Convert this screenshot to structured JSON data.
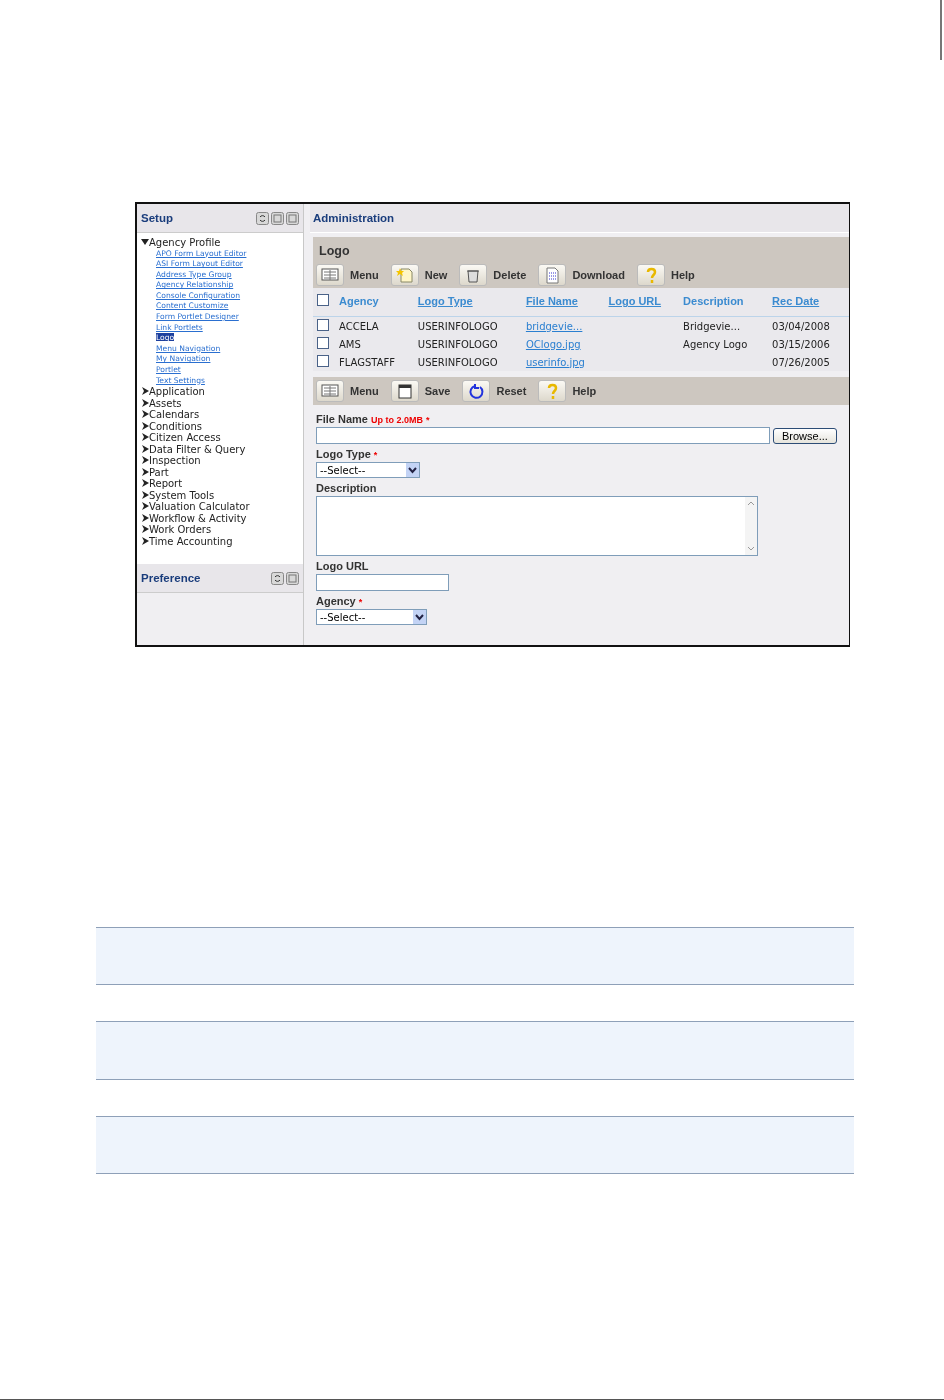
{
  "sidebar": {
    "title": "Setup",
    "tree": [
      {
        "label": "Agency Profile",
        "expanded": true,
        "children": [
          {
            "label": "APO Form Layout Editor",
            "selected": false
          },
          {
            "label": "ASI Form Layout Editor",
            "selected": false
          },
          {
            "label": "Address Type Group",
            "selected": false
          },
          {
            "label": "Agency Relationship",
            "selected": false
          },
          {
            "label": "Console Configuration",
            "selected": false
          },
          {
            "label": "Content Customize",
            "selected": false
          },
          {
            "label": "Form Portlet Designer",
            "selected": false
          },
          {
            "label": "Link Portlets",
            "selected": false
          },
          {
            "label": "Logo",
            "selected": true
          },
          {
            "label": "Menu Navigation",
            "selected": false
          },
          {
            "label": "My Navigation",
            "selected": false
          },
          {
            "label": "Portlet",
            "selected": false
          },
          {
            "label": "Text Settings",
            "selected": false
          }
        ]
      },
      {
        "label": "Application",
        "expanded": false
      },
      {
        "label": "Assets",
        "expanded": false
      },
      {
        "label": "Calendars",
        "expanded": false
      },
      {
        "label": "Conditions",
        "expanded": false
      },
      {
        "label": "Citizen Access",
        "expanded": false
      },
      {
        "label": "Data Filter & Query",
        "expanded": false
      },
      {
        "label": "Inspection",
        "expanded": false
      },
      {
        "label": "Part",
        "expanded": false
      },
      {
        "label": "Report",
        "expanded": false
      },
      {
        "label": "System Tools",
        "expanded": false
      },
      {
        "label": "Valuation Calculator",
        "expanded": false
      },
      {
        "label": "Workflow & Activity",
        "expanded": false
      },
      {
        "label": "Work Orders",
        "expanded": false
      },
      {
        "label": "Time Accounting",
        "expanded": false
      }
    ],
    "preference_title": "Preference"
  },
  "main": {
    "title": "Administration",
    "logo_panel": {
      "title": "Logo",
      "toolbar": [
        {
          "kind": "menu",
          "label": "Menu"
        },
        {
          "kind": "new",
          "label": "New"
        },
        {
          "kind": "delete",
          "label": "Delete"
        },
        {
          "kind": "download",
          "label": "Download"
        },
        {
          "kind": "help",
          "label": "Help"
        }
      ],
      "table": {
        "select_all_checked": false,
        "columns": [
          {
            "label": "Agency",
            "link": false
          },
          {
            "label": "Logo Type",
            "link": true
          },
          {
            "label": "File Name",
            "link": true
          },
          {
            "label": "Logo URL",
            "link": true
          },
          {
            "label": "Description",
            "link": false
          },
          {
            "label": "Rec Date",
            "link": true
          }
        ],
        "rows": [
          {
            "checked": false,
            "agency": "ACCELA",
            "logo_type": "USERINFOLOGO",
            "file_name": "bridgevie...",
            "description": "Bridgevie...",
            "rec_date": "03/04/2008"
          },
          {
            "checked": false,
            "agency": "AMS",
            "logo_type": "USERINFOLOGO",
            "file_name": "OClogo.jpg",
            "description": "Agency Logo",
            "rec_date": "03/15/2006"
          },
          {
            "checked": false,
            "agency": "FLAGSTAFF",
            "logo_type": "USERINFOLOGO",
            "file_name": "userinfo.jpg",
            "rec_date": "07/26/2005"
          }
        ]
      }
    },
    "form_toolbar": [
      {
        "kind": "menu",
        "label": "Menu"
      },
      {
        "kind": "save",
        "label": "Save"
      },
      {
        "kind": "reset",
        "label": "Reset"
      },
      {
        "kind": "help",
        "label": "Help"
      }
    ],
    "form": [
      {
        "kind": "file",
        "label": "File Name",
        "hint": "Up to 2.0MB",
        "required_mark": "*",
        "button": "Browse..."
      },
      {
        "kind": "select",
        "label": "Logo Type",
        "required_mark": "*",
        "value": "--Select--"
      },
      {
        "kind": "textarea",
        "label": "Description"
      },
      {
        "kind": "text",
        "label": "Logo URL"
      },
      {
        "kind": "select",
        "label": "Agency",
        "required_mark": "*",
        "value": "--Select--"
      }
    ]
  }
}
